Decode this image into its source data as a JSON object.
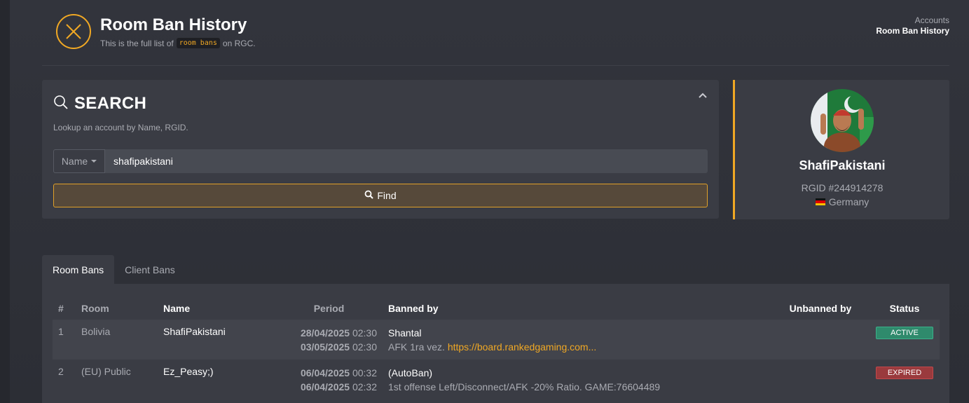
{
  "header": {
    "title": "Room Ban History",
    "subtitle_prefix": "This is the full list of",
    "subtitle_code": "room bans",
    "subtitle_suffix": "on RGC.",
    "icon": "close-circle-icon",
    "accent": "#f0a824"
  },
  "breadcrumb": {
    "parent": "Accounts",
    "current": "Room Ban History"
  },
  "search": {
    "title": "SEARCH",
    "description": "Lookup an account by Name, RGID.",
    "select_value": "Name",
    "input_value": "shafipakistani",
    "find_label": "Find"
  },
  "profile": {
    "name": "ShafiPakistani",
    "rgid": "RGID #244914278",
    "country": "Germany"
  },
  "tabs": [
    {
      "label": "Room Bans",
      "active": true
    },
    {
      "label": "Client Bans",
      "active": false
    }
  ],
  "table": {
    "headers": {
      "num": "#",
      "room": "Room",
      "name": "Name",
      "period": "Period",
      "banned_by": "Banned by",
      "unbanned_by": "Unbanned by",
      "status": "Status"
    },
    "rows": [
      {
        "num": "1",
        "room": "Bolivia",
        "name": "ShafiPakistani",
        "start_date": "28/04/2025",
        "start_time": "02:30",
        "end_date": "03/05/2025",
        "end_time": "02:30",
        "banned_by": "Shantal",
        "reason": "AFK 1ra vez.",
        "link": "https://board.rankedgaming.com...",
        "unbanned_by": "",
        "status": "ACTIVE"
      },
      {
        "num": "2",
        "room": "(EU) Public",
        "name": "Ez_Peasy;)",
        "start_date": "06/04/2025",
        "start_time": "00:32",
        "end_date": "06/04/2025",
        "end_time": "02:32",
        "banned_by": "(AutoBan)",
        "reason": "1st offense Left/Disconnect/AFK -20% Ratio. GAME:76604489",
        "link": "",
        "unbanned_by": "",
        "status": "EXPIRED"
      }
    ]
  },
  "colors": {
    "active_badge": "#2f8a6c",
    "expired_badge": "#9a3a3d",
    "link": "#f0a824"
  }
}
